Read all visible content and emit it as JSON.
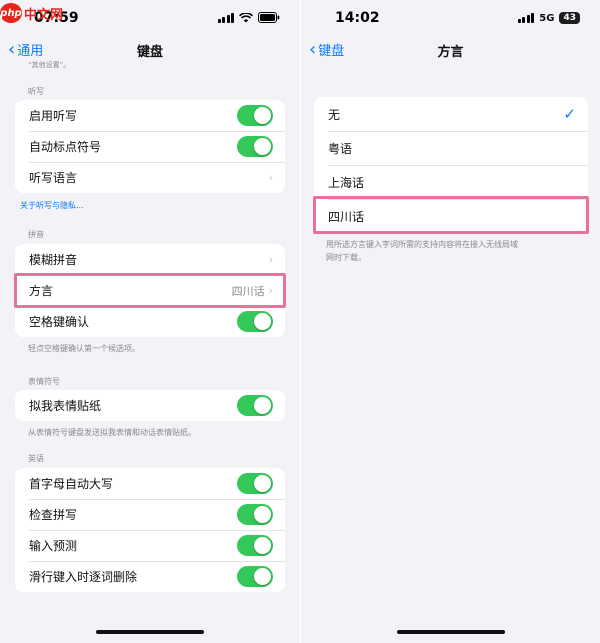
{
  "watermark": {
    "badge": "php",
    "text": "中文网"
  },
  "left": {
    "status": {
      "time": "07:59"
    },
    "nav": {
      "back_label": "通用",
      "title": "键盘"
    },
    "top_cut_text": "“其他设置”。",
    "dictation": {
      "header": "听写",
      "items": [
        {
          "label": "启用听写",
          "control": "toggle",
          "on": true
        },
        {
          "label": "自动标点符号",
          "control": "toggle",
          "on": true
        },
        {
          "label": "听写语言",
          "control": "chevron"
        }
      ],
      "footer_link": "关于听写与隐私..."
    },
    "pinyin": {
      "header": "拼音",
      "items": [
        {
          "label": "模糊拼音",
          "control": "chevron"
        },
        {
          "label": "方言",
          "control": "chevron",
          "value": "四川话"
        },
        {
          "label": "空格键确认",
          "control": "toggle",
          "on": true
        }
      ],
      "footer": "轻点空格键确认第一个候选项。"
    },
    "emoji": {
      "header": "表情符号",
      "items": [
        {
          "label": "拟我表情贴纸",
          "control": "toggle",
          "on": true
        }
      ],
      "footer": "从表情符号键盘发送拟我表情和动话表情贴纸。"
    },
    "english": {
      "header": "英语",
      "items": [
        {
          "label": "首字母自动大写",
          "control": "toggle",
          "on": true
        },
        {
          "label": "检查拼写",
          "control": "toggle",
          "on": true
        },
        {
          "label": "输入预测",
          "control": "toggle",
          "on": true
        },
        {
          "label": "滑行键入时逐词删除",
          "control": "toggle",
          "on": true
        }
      ]
    }
  },
  "right": {
    "status": {
      "time": "14:02",
      "network": "5G",
      "battery": "43"
    },
    "nav": {
      "back_label": "键盘",
      "title": "方言"
    },
    "options": [
      {
        "label": "无",
        "selected": true
      },
      {
        "label": "粤语",
        "selected": false
      },
      {
        "label": "上海话",
        "selected": false
      },
      {
        "label": "四川话",
        "selected": false
      }
    ],
    "footer_lines": [
      "用所选方言键入字词所需的支持内容将在接入无线局域",
      "网时下载。"
    ]
  },
  "colors": {
    "accent": "#0a7aff",
    "toggle_on": "#34c759",
    "highlight": "#e8739a",
    "background": "#f2f2f7"
  }
}
